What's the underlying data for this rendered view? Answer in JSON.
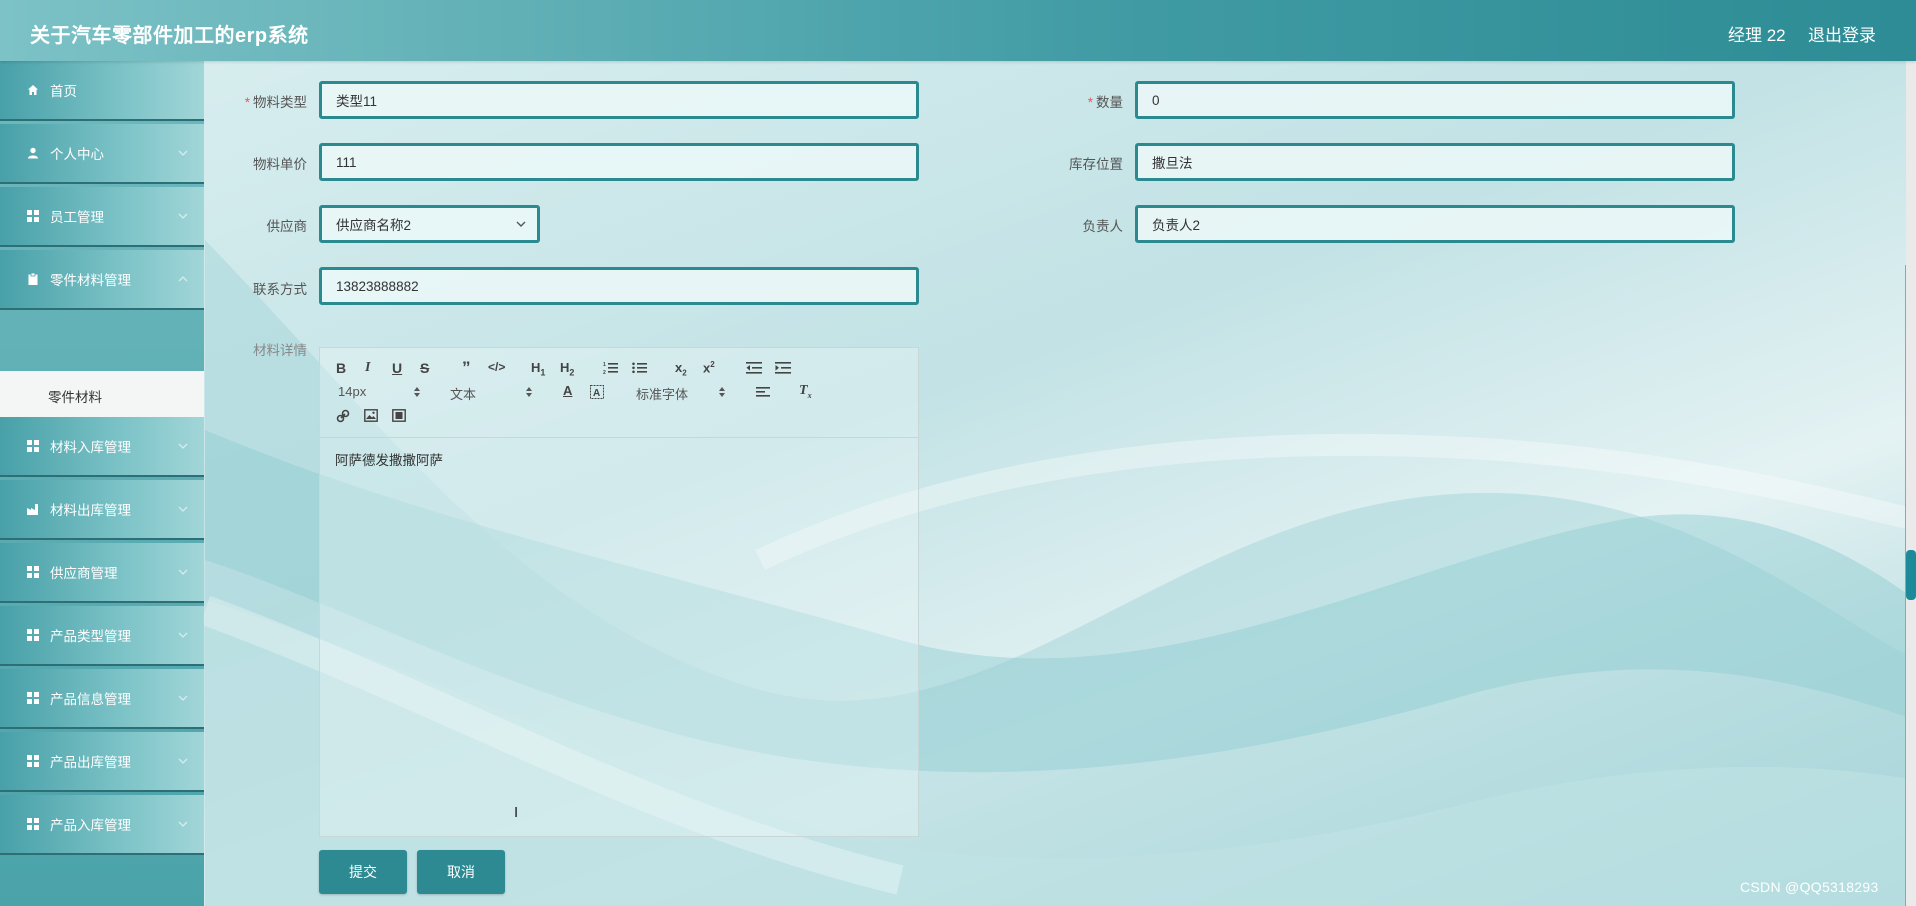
{
  "app": {
    "title": "关于汽车零部件加工的erp系统",
    "user": "经理 22",
    "logout": "退出登录"
  },
  "sidebar": {
    "items": [
      {
        "label": "首页",
        "icon": "home-icon"
      },
      {
        "label": "个人中心",
        "icon": "user-icon"
      },
      {
        "label": "员工管理",
        "icon": "grid-icon"
      },
      {
        "label": "零件材料管理",
        "icon": "clipboard-icon"
      },
      {
        "label": "材料入库管理",
        "icon": "grid-icon"
      },
      {
        "label": "材料出库管理",
        "icon": "factory-icon"
      },
      {
        "label": "供应商管理",
        "icon": "grid-icon"
      },
      {
        "label": "产品类型管理",
        "icon": "grid-icon"
      },
      {
        "label": "产品信息管理",
        "icon": "grid-icon"
      },
      {
        "label": "产品出库管理",
        "icon": "grid-icon"
      },
      {
        "label": "产品入库管理",
        "icon": "grid-icon"
      }
    ],
    "sub_item": "零件材料"
  },
  "form": {
    "material_type": {
      "label": "物料类型",
      "value": "类型11"
    },
    "quantity": {
      "label": "数量",
      "value": "0"
    },
    "unit_price": {
      "label": "物料单价",
      "value": "111"
    },
    "location": {
      "label": "库存位置",
      "value": "撒旦法"
    },
    "supplier": {
      "label": "供应商",
      "value": "供应商名称2"
    },
    "manager": {
      "label": "负责人",
      "value": "负责人2"
    },
    "contact": {
      "label": "联系方式",
      "value": "13823888882"
    },
    "details": {
      "label": "材料详情",
      "content": "阿萨德发撒撒阿萨"
    }
  },
  "editor": {
    "font_size": "14px",
    "block_type": "文本",
    "font_family": "标准字体"
  },
  "buttons": {
    "submit": "提交",
    "cancel": "取消"
  },
  "watermark": "CSDN @QQ5318293",
  "colors": {
    "accent": "#2d8a92",
    "header": "#3f9aa3",
    "required": "#e55555"
  }
}
